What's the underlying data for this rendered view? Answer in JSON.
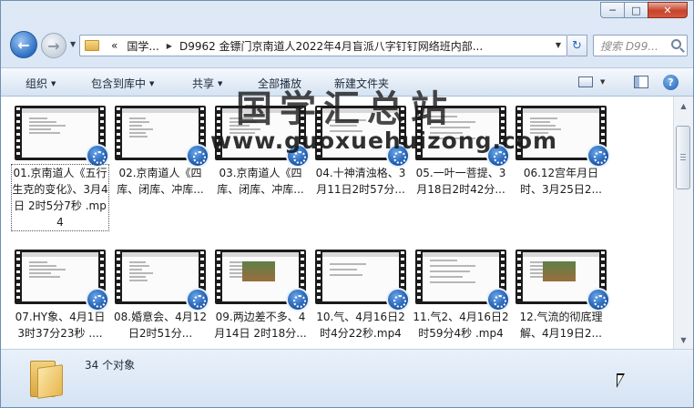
{
  "window": {
    "caption_min": "─",
    "caption_max": "□",
    "caption_close": "✕"
  },
  "address": {
    "overflow": "«",
    "crumb1": "国学...",
    "crumb2": "D9962 金镖门京南道人2022年4月盲派八字钉钉网络班内部...",
    "refresh_glyph": "↻"
  },
  "search": {
    "placeholder": "搜索 D99..."
  },
  "toolbar": {
    "organize": "组织",
    "include_in_library": "包含到库中",
    "share": "共享",
    "play_all": "全部播放",
    "new_folder": "新建文件夹",
    "help": "?"
  },
  "files": [
    {
      "name": "01.京南道人《五行生克的变化》、3月4日 2时5分7秒 .mp4",
      "selected": true
    },
    {
      "name": "02.京南道人《四库、闭库、冲库...",
      "selected": false
    },
    {
      "name": "03.京南道人《四库、闭库、冲库...",
      "selected": false
    },
    {
      "name": "04.十神清浊格、3月11日2时57分...",
      "selected": false
    },
    {
      "name": "05.一叶一菩提、3月18日2时42分...",
      "selected": false
    },
    {
      "name": "06.12宫年月日时、3月25日2...",
      "selected": false
    },
    {
      "name": "07.HY象、4月1日3时37分23秒 ....",
      "selected": false
    },
    {
      "name": "08.婚意会、4月12日2时51分...",
      "selected": false
    },
    {
      "name": "09.两边差不多、4月14日 2时18分...",
      "selected": false
    },
    {
      "name": "10.气、4月16日2时4分22秒.mp4",
      "selected": false
    },
    {
      "name": "11.气2、4月16日2时59分4秒 .mp4",
      "selected": false
    },
    {
      "name": "12.气流的彻底理解、4月19日2...",
      "selected": false
    }
  ],
  "watermark": {
    "cn": "国学汇总站",
    "url": "www.guoxuehuizong.com"
  },
  "status": {
    "count": "34 个对象"
  },
  "colors": {
    "accent": "#2d6fc2",
    "toolbar_bg": "#e2ebf6",
    "close": "#c7432c"
  }
}
